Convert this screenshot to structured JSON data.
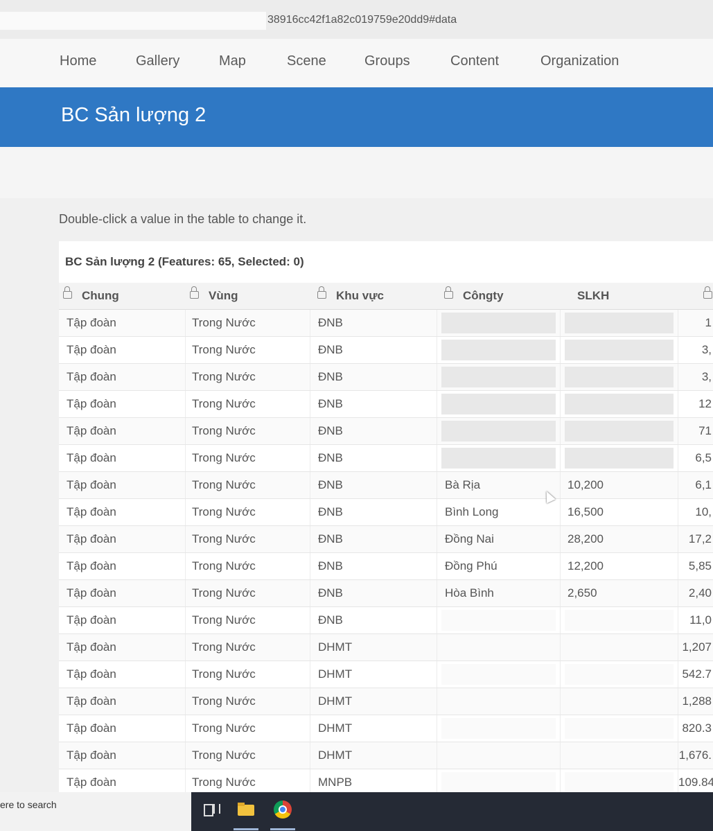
{
  "url": "38916cc42f1a82c019759e20dd9#data",
  "nav": [
    "Home",
    "Gallery",
    "Map",
    "Scene",
    "Groups",
    "Content",
    "Organization"
  ],
  "banner_title": "BC Sản lượng 2",
  "hint": "Double-click a value in the table to change it.",
  "table": {
    "caption": "BC Sản lượng 2 (Features: 65, Selected: 0)",
    "columns": [
      "Chung",
      "Vùng",
      "Khu vực",
      "Côngty",
      "SLKH",
      ""
    ],
    "locked_columns": [
      true,
      true,
      true,
      true,
      false,
      true
    ],
    "rows": [
      {
        "chung": "Tập đoàn",
        "vung": "Trong Nước",
        "khuvuc": "ĐNB",
        "congty": "",
        "slkh": "",
        "last": "1"
      },
      {
        "chung": "Tập đoàn",
        "vung": "Trong Nước",
        "khuvuc": "ĐNB",
        "congty": "",
        "slkh": "",
        "last": "3,"
      },
      {
        "chung": "Tập đoàn",
        "vung": "Trong Nước",
        "khuvuc": "ĐNB",
        "congty": "",
        "slkh": "",
        "last": "3,"
      },
      {
        "chung": "Tập đoàn",
        "vung": "Trong Nước",
        "khuvuc": "ĐNB",
        "congty": "",
        "slkh": "",
        "last": "12"
      },
      {
        "chung": "Tập đoàn",
        "vung": "Trong Nước",
        "khuvuc": "ĐNB",
        "congty": "",
        "slkh": "",
        "last": "71"
      },
      {
        "chung": "Tập đoàn",
        "vung": "Trong Nước",
        "khuvuc": "ĐNB",
        "congty": "",
        "slkh": "",
        "last": "6,5"
      },
      {
        "chung": "Tập đoàn",
        "vung": "Trong Nước",
        "khuvuc": "ĐNB",
        "congty": "Bà Rịa",
        "slkh": "10,200",
        "last": "6,1"
      },
      {
        "chung": "Tập đoàn",
        "vung": "Trong Nước",
        "khuvuc": "ĐNB",
        "congty": "Bình Long",
        "slkh": "16,500",
        "last": "10,"
      },
      {
        "chung": "Tập đoàn",
        "vung": "Trong Nước",
        "khuvuc": "ĐNB",
        "congty": "Đồng Nai",
        "slkh": "28,200",
        "last": "17,2"
      },
      {
        "chung": "Tập đoàn",
        "vung": "Trong Nước",
        "khuvuc": "ĐNB",
        "congty": "Đồng Phú",
        "slkh": "12,200",
        "last": "5,85"
      },
      {
        "chung": "Tập đoàn",
        "vung": "Trong Nước",
        "khuvuc": "ĐNB",
        "congty": "Hòa Bình",
        "slkh": "2,650",
        "last": "2,40"
      },
      {
        "chung": "Tập đoàn",
        "vung": "Trong Nước",
        "khuvuc": "ĐNB",
        "congty": "",
        "slkh": "",
        "last": "11,0"
      },
      {
        "chung": "Tập đoàn",
        "vung": "Trong Nước",
        "khuvuc": "DHMT",
        "congty": "",
        "slkh": "",
        "last": "1,207"
      },
      {
        "chung": "Tập đoàn",
        "vung": "Trong Nước",
        "khuvuc": "DHMT",
        "congty": "",
        "slkh": "",
        "last": "542.7"
      },
      {
        "chung": "Tập đoàn",
        "vung": "Trong Nước",
        "khuvuc": "DHMT",
        "congty": "",
        "slkh": "",
        "last": "1,288"
      },
      {
        "chung": "Tập đoàn",
        "vung": "Trong Nước",
        "khuvuc": "DHMT",
        "congty": "",
        "slkh": "",
        "last": "820.3"
      },
      {
        "chung": "Tập đoàn",
        "vung": "Trong Nước",
        "khuvuc": "DHMT",
        "congty": "",
        "slkh": "",
        "last": "1,676."
      },
      {
        "chung": "Tập đoàn",
        "vung": "Trong Nước",
        "khuvuc": "MNPB",
        "congty": "",
        "slkh": "",
        "last": "109.84"
      }
    ]
  },
  "taskbar": {
    "search_text": "ere to search",
    "icons": [
      "task-view-icon",
      "file-explorer-icon",
      "chrome-icon"
    ]
  },
  "colors": {
    "banner": "#2f78c4",
    "taskbar": "#252a35"
  }
}
